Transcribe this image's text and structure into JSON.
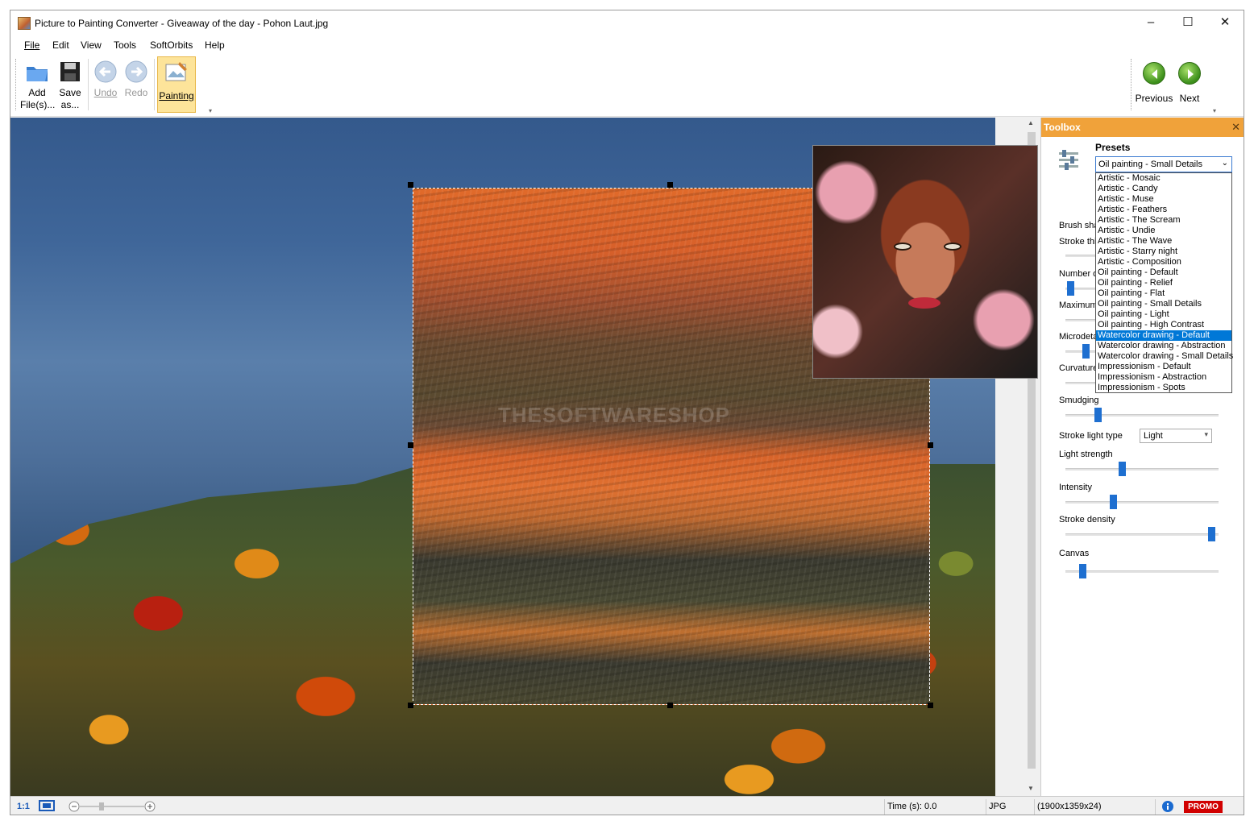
{
  "window": {
    "title": "Picture to Painting Converter - Giveaway of the day - Pohon Laut.jpg"
  },
  "menu": [
    "File",
    "Edit",
    "View",
    "Tools",
    "SoftOrbits",
    "Help"
  ],
  "toolbar": {
    "add_label": "Add\nFile(s)...",
    "save_label": "Save\nas...",
    "undo_label": "Undo",
    "redo_label": "Redo",
    "painting_label": "Painting",
    "previous_label": "Previous",
    "next_label": "Next"
  },
  "canvas": {
    "watermark": "THESOFTWARESHOP"
  },
  "toolbox": {
    "title": "Toolbox",
    "presets_label": "Presets",
    "presets_value": "Oil painting - Small Details",
    "presets_options": [
      "Artistic - Mosaic",
      "Artistic - Candy",
      "Artistic - Muse",
      "Artistic - Feathers",
      "Artistic - The Scream",
      "Artistic - Undie",
      "Artistic - The Wave",
      "Artistic - Starry night",
      "Artistic - Composition",
      "Oil painting - Default",
      "Oil painting - Relief",
      "Oil painting - Flat",
      "Oil painting - Small Details",
      "Oil painting - Light",
      "Oil painting - High Contrast",
      "Watercolor drawing - Default",
      "Watercolor drawing - Abstraction",
      "Watercolor drawing - Small Details",
      "Impressionism - Default",
      "Impressionism - Abstraction",
      "Impressionism - Spots"
    ],
    "highlighted_option": "Watercolor drawing - Default",
    "params": {
      "brush_shape": "Brush sha",
      "stroke_thickness": "Stroke thi",
      "number_of": "Number o",
      "maximum": "Maximum",
      "microdetails": "Microdeta",
      "curvature": "Curvature",
      "smudging": "Smudging",
      "stroke_light_type": "Stroke light type",
      "light_strength": "Light strength",
      "intensity": "Intensity",
      "stroke_density": "Stroke density",
      "canvas": "Canvas"
    },
    "stroke_light_value": "Light",
    "slider_levels": {
      "number_of": 0.03,
      "microdetails": 0.13,
      "smudging": 0.21,
      "light_strength": 0.37,
      "intensity": 0.31,
      "stroke_density": 0.95,
      "canvas": 0.11
    }
  },
  "statusbar": {
    "ratio": "1:1",
    "time": "Time (s): 0.0",
    "format": "JPG",
    "dimensions": "(1900x1359x24)",
    "promo": "PROMO"
  }
}
